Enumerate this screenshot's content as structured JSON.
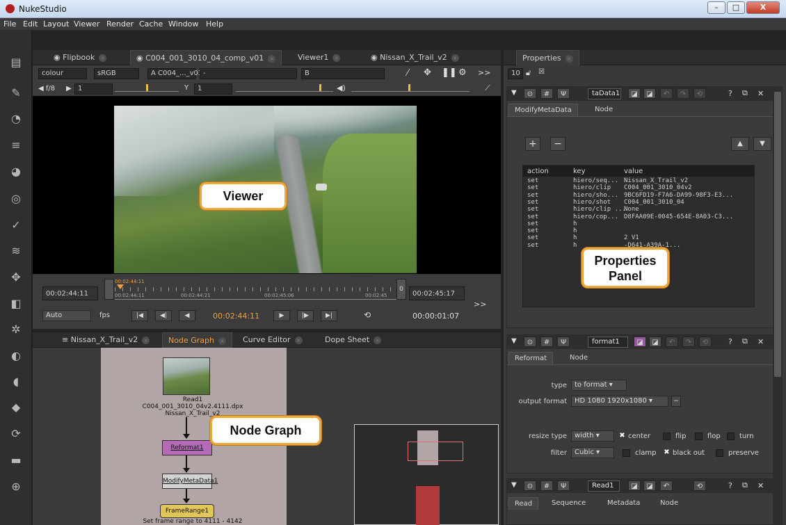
{
  "window": {
    "title": "NukeStudio",
    "controls": {
      "minimize": "–",
      "maximize": "□",
      "close": "X"
    }
  },
  "menu": [
    "File",
    "Edit",
    "Layout",
    "Viewer",
    "Render",
    "Cache",
    "Window",
    "Help"
  ],
  "viewer": {
    "tabs": [
      {
        "label": "Flipbook"
      },
      {
        "label": "C004_001_3010_04_comp_v01"
      },
      {
        "label": "Viewer1"
      },
      {
        "label": "Nissan_X_Trail_v2"
      }
    ],
    "channel": "colour",
    "colorspace": "sRGB",
    "input_a": "A  C004_..._v01*",
    "input_a_extra": "-",
    "input_b": "B",
    "fstop": "f/8",
    "gain_value": "1",
    "gamma_label": "Y",
    "gamma_value": "1",
    "timeline": {
      "in_time": "00:02:44:11",
      "current_marker": "00:02:44:11",
      "tick1": "00:02:44:11",
      "tick2": "00:02:44:21",
      "tick3": "00:02:45:06",
      "tick4": "00:02:45",
      "out_label": "0",
      "out_time": "00:02:45:17",
      "more": ">>",
      "mode": "Auto",
      "fps_label": "fps",
      "current_time": "00:02:44:11",
      "duration": "00:00:01:07"
    },
    "callout": "Viewer"
  },
  "nodegraph": {
    "tabs": [
      {
        "label": "Nissan_X_Trail_v2"
      },
      {
        "label": "Node Graph"
      },
      {
        "label": "Curve Editor"
      },
      {
        "label": "Dope Sheet"
      }
    ],
    "nodes": {
      "read_name": "Read1",
      "read_file": "C004_001_3010_04v2.4111.dpx",
      "read_sub": "Nissan_X_Trail_v2",
      "reformat": "Reformat1",
      "modify": "ModifyMetaData1",
      "framerange": "FrameRange1",
      "framerange_sub": "Set frame range to 4111 - 4142"
    },
    "callout": "Node Graph"
  },
  "properties": {
    "tab": "Properties",
    "max_panels": "10",
    "panel1": {
      "name": "taData1",
      "tabs": [
        "ModifyMetaData",
        "Node"
      ],
      "headers": [
        "action",
        "key",
        "value"
      ],
      "rows": [
        [
          "set",
          "hiero/seq...",
          "Nissan_X_Trail_v2"
        ],
        [
          "set",
          "hiero/clip",
          "C004_001_3010_04v2"
        ],
        [
          "set",
          "hiero/sho...",
          "9BC6FD19-F7A6-DA99-98F3-E3..."
        ],
        [
          "set",
          "hiero/shot",
          "C004_001_3010_04"
        ],
        [
          "set",
          "hiero/clip ...",
          "None"
        ],
        [
          "set",
          "hiero/cop...",
          "D8FAA09E-0045-654E-8A03-C3..."
        ],
        [
          "set",
          "h",
          ""
        ],
        [
          "set",
          "h",
          ""
        ],
        [
          "set",
          "h",
          "2 V1"
        ],
        [
          "set",
          "h",
          "-D641-A39A-1..."
        ]
      ]
    },
    "panel2": {
      "name": "format1",
      "tabs": [
        "Reformat",
        "Node"
      ],
      "type_label": "type",
      "type_value": "to format",
      "output_label": "output format",
      "output_value": "HD 1080 1920x1080",
      "resize_label": "resize type",
      "resize_value": "width",
      "center": "center",
      "flip": "flip",
      "flop": "flop",
      "turn": "turn",
      "filter_label": "filter",
      "filter_value": "Cubic",
      "clamp": "clamp",
      "blackout": "black out",
      "preserve": "preserve"
    },
    "panel3": {
      "name": "Read1",
      "tabs": [
        "Read",
        "Sequence",
        "Metadata",
        "Node"
      ]
    },
    "callout_line1": "Properties",
    "callout_line2": "Panel"
  },
  "colors": {
    "accent": "#f0a73a",
    "orange_text": "#f0a040"
  },
  "icons": {
    "tab_close": "×"
  }
}
